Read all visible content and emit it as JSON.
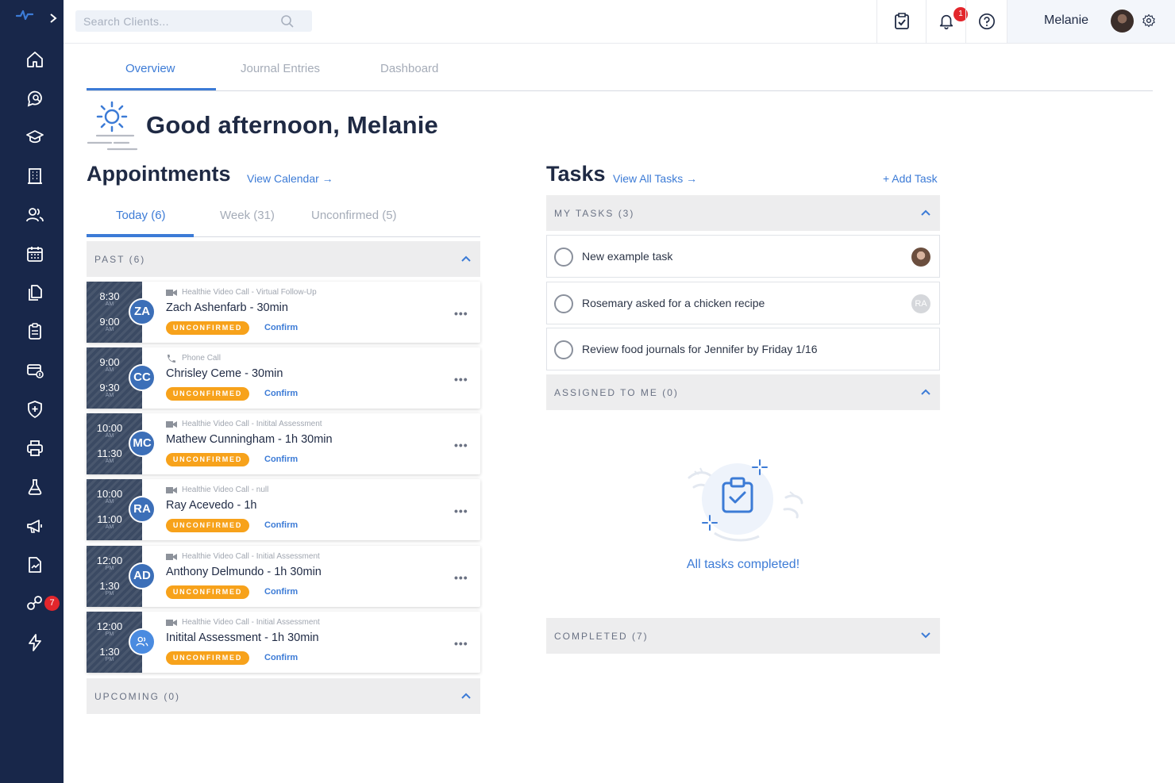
{
  "search": {
    "placeholder": "Search Clients..."
  },
  "topbar": {
    "notification_count": "1",
    "user_name": "Melanie"
  },
  "sidebar": {
    "badge_count": "7"
  },
  "main_tabs": [
    {
      "label": "Overview"
    },
    {
      "label": "Journal Entries"
    },
    {
      "label": "Dashboard"
    }
  ],
  "greeting": "Good afternoon, Melanie",
  "appointments": {
    "title": "Appointments",
    "view_calendar": "View Calendar →",
    "tabs": [
      {
        "label": "Today (6)"
      },
      {
        "label": "Week (31)"
      },
      {
        "label": "Unconfirmed (5)"
      }
    ],
    "past_label": "PAST (6)",
    "upcoming_label": "UPCOMING (0)",
    "items": [
      {
        "start": "8:30",
        "start_ampm": "AM",
        "end": "9:00",
        "end_ampm": "AM",
        "initials": "ZA",
        "type": "Healthie Video Call - Virtual Follow-Up",
        "type_icon": "video-icon",
        "name": "Zach Ashenfarb - 30min",
        "status": "UNCONFIRMED",
        "confirm": "Confirm"
      },
      {
        "start": "9:00",
        "start_ampm": "AM",
        "end": "9:30",
        "end_ampm": "AM",
        "initials": "CC",
        "type": "Phone Call",
        "type_icon": "phone-icon",
        "name": "Chrisley Ceme - 30min",
        "status": "UNCONFIRMED",
        "confirm": "Confirm"
      },
      {
        "start": "10:00",
        "start_ampm": "AM",
        "end": "11:30",
        "end_ampm": "AM",
        "initials": "MC",
        "type": "Healthie Video Call - Initital Assessment",
        "type_icon": "video-icon",
        "name": "Mathew Cunningham - 1h 30min",
        "status": "UNCONFIRMED",
        "confirm": "Confirm"
      },
      {
        "start": "10:00",
        "start_ampm": "AM",
        "end": "11:00",
        "end_ampm": "AM",
        "initials": "RA",
        "type": "Healthie Video Call - null",
        "type_icon": "video-icon",
        "name": "Ray Acevedo - 1h",
        "status": "UNCONFIRMED",
        "confirm": "Confirm"
      },
      {
        "start": "12:00",
        "start_ampm": "PM",
        "end": "1:30",
        "end_ampm": "PM",
        "initials": "AD",
        "type": "Healthie Video Call - Initial Assessment",
        "type_icon": "video-icon",
        "name": "Anthony Delmundo - 1h 30min",
        "status": "UNCONFIRMED",
        "confirm": "Confirm"
      },
      {
        "start": "12:00",
        "start_ampm": "PM",
        "end": "1:30",
        "end_ampm": "PM",
        "initials": "",
        "avatar_icon": "group-icon",
        "type": "Healthie Video Call - Initial Assessment",
        "type_icon": "video-icon",
        "name": "Initital Assessment - 1h 30min",
        "status": "UNCONFIRMED",
        "confirm": "Confirm"
      }
    ]
  },
  "tasks": {
    "title": "Tasks",
    "view_all": "View All Tasks →",
    "add": "+ Add Task",
    "my_tasks_label": "MY TASKS (3)",
    "assigned_label": "ASSIGNED TO ME (0)",
    "completed_label": "COMPLETED (7)",
    "empty_text": "All tasks completed!",
    "items": [
      {
        "label": "New example task",
        "assignee": "photo"
      },
      {
        "label": "Rosemary asked for a chicken recipe",
        "assignee_initials": "RA"
      },
      {
        "label": "Review food journals for Jennifer by Friday 1/16"
      }
    ]
  },
  "colors": {
    "sidebar": "#18274a",
    "accent": "#3c7bd6",
    "status_unconfirmed": "#f7a21b",
    "badge": "#e3262c"
  }
}
